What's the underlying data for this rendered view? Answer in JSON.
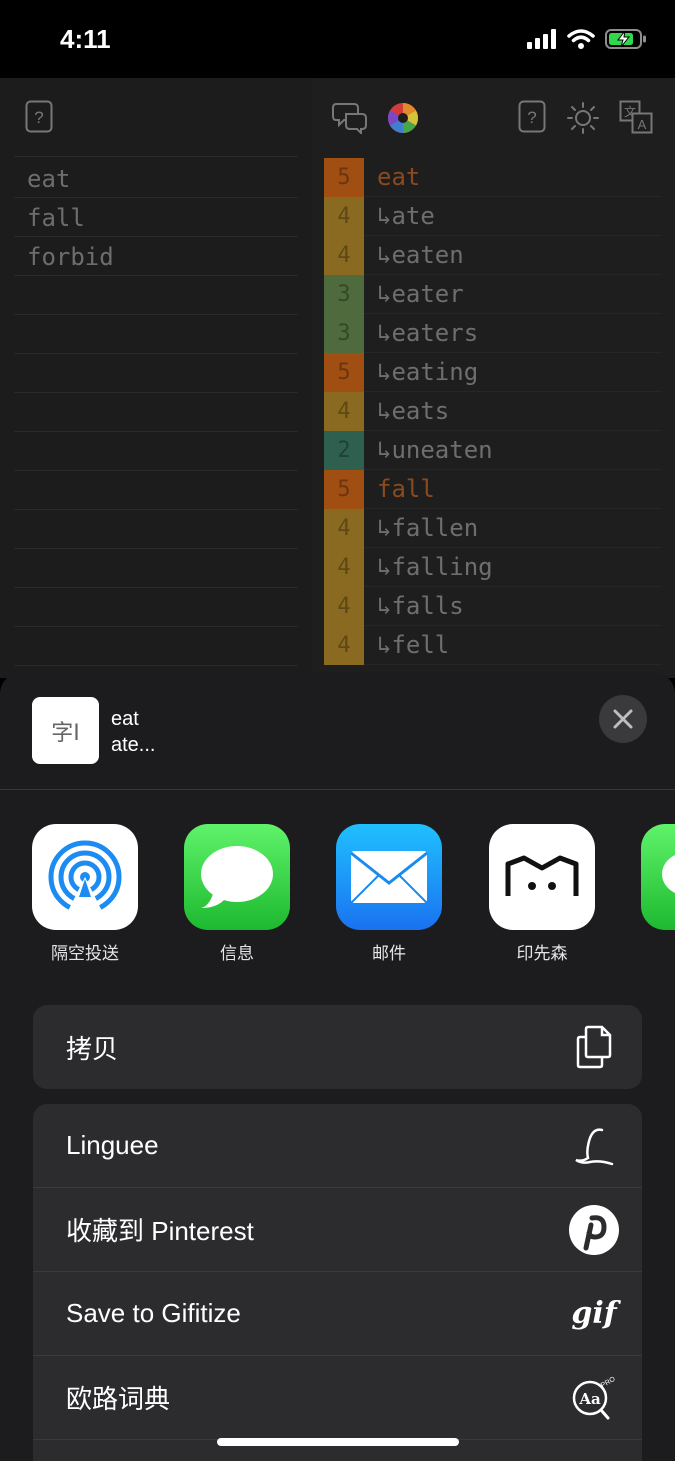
{
  "status": {
    "time": "4:11"
  },
  "left_words": [
    "eat",
    "fall",
    "forbid"
  ],
  "word_rows": [
    {
      "level": "5",
      "word": "eat",
      "head": true,
      "color": "#a14e12"
    },
    {
      "level": "4",
      "word": "↳ate",
      "head": false,
      "color": "#8a6a20"
    },
    {
      "level": "4",
      "word": "↳eaten",
      "head": false,
      "color": "#8a6a20"
    },
    {
      "level": "3",
      "word": "↳eater",
      "head": false,
      "color": "#4f6a3c"
    },
    {
      "level": "3",
      "word": "↳eaters",
      "head": false,
      "color": "#4f6a3c"
    },
    {
      "level": "5",
      "word": "↳eating",
      "head": false,
      "color": "#a14e12"
    },
    {
      "level": "4",
      "word": "↳eats",
      "head": false,
      "color": "#8a6a20"
    },
    {
      "level": "2",
      "word": "↳uneaten",
      "head": false,
      "color": "#2f5f4e"
    },
    {
      "level": "5",
      "word": "fall",
      "head": true,
      "color": "#a14e12"
    },
    {
      "level": "4",
      "word": "↳fallen",
      "head": false,
      "color": "#8a6a20"
    },
    {
      "level": "4",
      "word": "↳falling",
      "head": false,
      "color": "#8a6a20"
    },
    {
      "level": "4",
      "word": "↳falls",
      "head": false,
      "color": "#8a6a20"
    },
    {
      "level": "4",
      "word": "↳fell",
      "head": false,
      "color": "#8a6a20"
    }
  ],
  "share": {
    "thumb_glyph": "字I",
    "title_line1": "eat",
    "title_line2": "ate...",
    "apps": [
      {
        "label": "隔空投送",
        "icon": "airdrop-icon"
      },
      {
        "label": "信息",
        "icon": "messages-icon"
      },
      {
        "label": "邮件",
        "icon": "mail-icon"
      },
      {
        "label": "印先森",
        "icon": "yinxiansen-icon"
      }
    ],
    "copy_label": "拷贝",
    "actions": [
      {
        "label": "Linguee",
        "icon": "linguee-icon"
      },
      {
        "label": "收藏到 Pinterest",
        "icon": "pinterest-icon"
      },
      {
        "label": "Save to Gifitize",
        "icon": "gifitize-icon"
      },
      {
        "label": "欧路词典",
        "icon": "eudic-icon"
      }
    ]
  }
}
